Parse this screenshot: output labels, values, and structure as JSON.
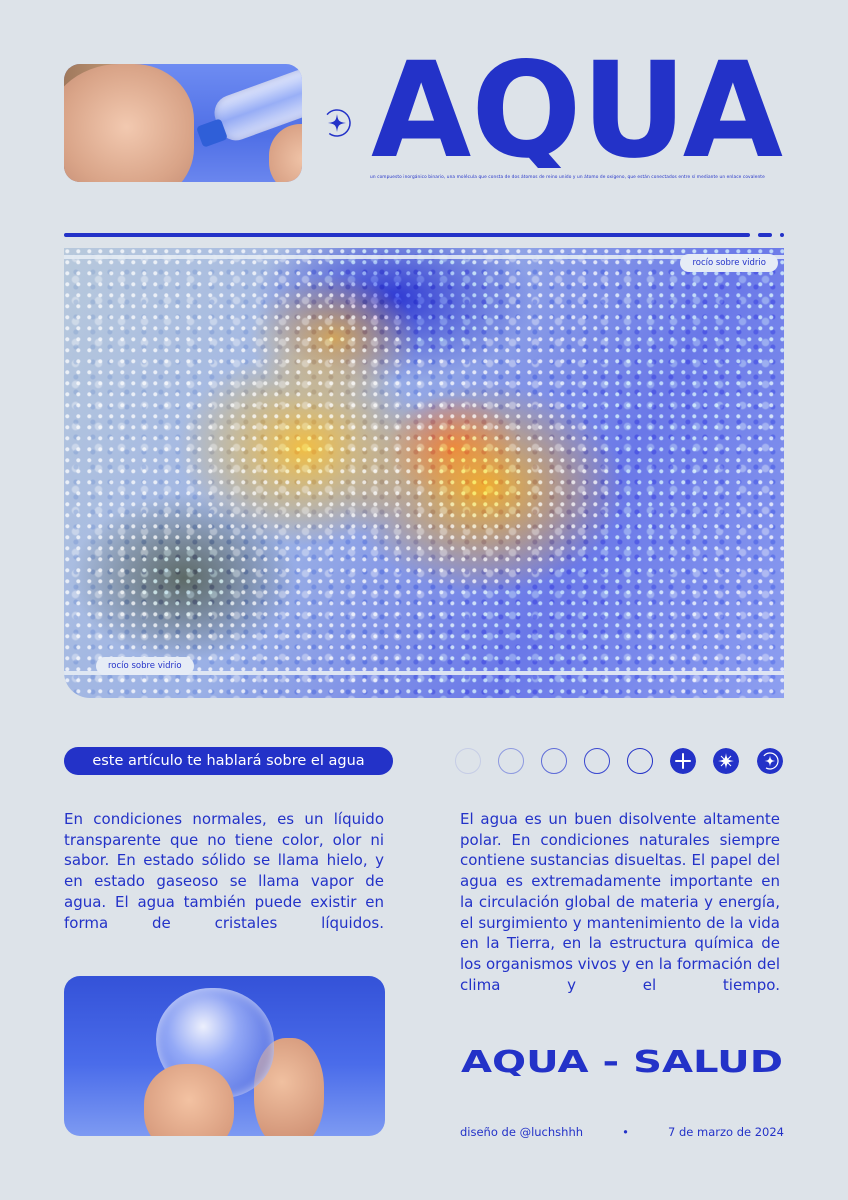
{
  "header": {
    "title": "AQUA",
    "subtitle": "un compuesto inorgánico binario, una molécula que consta de dos átomos de reino unido y un átomo de oxígeno, que están conectados entre sí mediante un enlace covalente"
  },
  "hero": {
    "tag_top": "rocío sobre vidrio",
    "tag_bottom": "rocío sobre vidrio"
  },
  "pill_label": "este artículo te hablará sobre el agua",
  "circles": [
    {
      "style": "outline-faint"
    },
    {
      "style": "outline"
    },
    {
      "style": "outline"
    },
    {
      "style": "outline"
    },
    {
      "style": "outline"
    },
    {
      "style": "filled",
      "icon": "plus-icon"
    },
    {
      "style": "filled",
      "icon": "star-icon"
    },
    {
      "style": "filled",
      "icon": "sparkle-icon"
    }
  ],
  "body": {
    "left": "En condiciones normales, es un líquido transparente que no tiene color, olor ni sabor. En estado sólido se llama hielo, y en estado gaseoso se llama vapor de agua. El agua también puede existir en forma de cristales líquidos.",
    "right": "El agua es un buen disolvente altamente polar. En condiciones naturales siempre contiene sustancias disueltas. El papel del agua es extremadamente importante en la circulación global de materia y energía, el surgimiento y mantenimiento de la vida en la Tierra, en la estructura química de los organismos vivos y en la formación del clima y el tiempo."
  },
  "tagline": "AQUA - SALUD",
  "credits": {
    "designer": "diseño de @luchshhh",
    "separator": "•",
    "date": "7 de marzo de 2024"
  },
  "colors": {
    "accent": "#2332c8",
    "background": "#dde3e9"
  }
}
